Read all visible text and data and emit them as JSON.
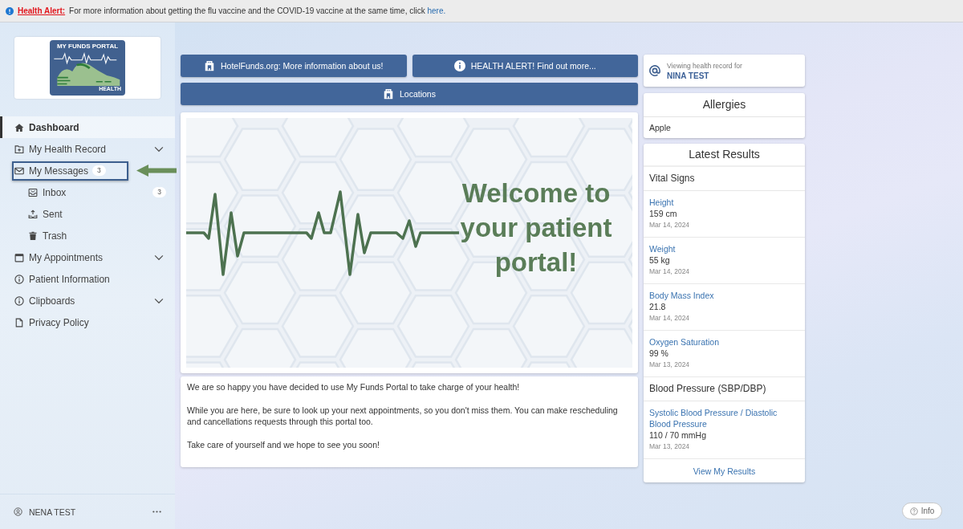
{
  "alert_bar": {
    "title": "Health Alert:",
    "message": "For more information about getting the flu vaccine and the COVID-19 vaccine at the same time, click",
    "link": "here."
  },
  "sidebar": {
    "logo": {
      "title": "MY FUNDS PORTAL",
      "subtitle": "HEALTH"
    },
    "items": [
      {
        "label": "Dashboard",
        "selected": true,
        "highlighted": false
      },
      {
        "label": "My Health Record",
        "selected": false,
        "highlighted": false,
        "expanded": false
      },
      {
        "label": "My Messages",
        "selected": false,
        "highlighted": true,
        "expanded": true,
        "badge": "3",
        "children": [
          {
            "label": "Inbox",
            "selected": false,
            "badge": "3"
          },
          {
            "label": "Sent",
            "selected": false
          },
          {
            "label": "Trash",
            "selected": false
          }
        ]
      },
      {
        "label": "My Appointments",
        "selected": false,
        "highlighted": false,
        "expanded": false
      },
      {
        "label": "Patient Information",
        "selected": false,
        "highlighted": false
      },
      {
        "label": "Clipboards",
        "selected": false,
        "highlighted": false,
        "expanded": false
      },
      {
        "label": "Privacy Policy",
        "selected": false,
        "highlighted": false
      }
    ],
    "user": {
      "name": "NENA TEST"
    }
  },
  "actions": [
    [
      {
        "label": "HotelFunds.org: More information about us!"
      },
      {
        "label": "HEALTH ALERT! Find out more..."
      }
    ],
    [
      {
        "label": "Locations"
      }
    ]
  ],
  "banner": {
    "heading": "Welcome to your patient portal!"
  },
  "welcome_text": [
    "We are so happy you have decided to use My Funds Portal to take charge of your health!",
    "While you are here, be sure to look up your next appointments, so you don't miss them. You can make rescheduling and cancellations requests through this portal too.",
    "Take care of yourself and we hope to see you soon!"
  ],
  "health_record": {
    "caption": "Viewing health record for",
    "name": "NINA TEST"
  },
  "allergies": {
    "title": "Allergies",
    "items": [
      "Apple"
    ]
  },
  "latest_results": {
    "title": "Latest Results",
    "groups": [
      {
        "title": "Vital Signs",
        "results": [
          {
            "name": "Height",
            "value": "159 cm",
            "date": "Mar 14, 2024"
          },
          {
            "name": "Weight",
            "value": "55 kg",
            "date": "Mar 14, 2024"
          },
          {
            "name": "Body Mass Index",
            "value": "21.8",
            "date": "Mar 14, 2024"
          },
          {
            "name": "Oxygen Saturation",
            "value": "99 %",
            "date": "Mar 13, 2024"
          }
        ]
      },
      {
        "title": "Blood Pressure (SBP/DBP)",
        "results": [
          {
            "name": "Systolic Blood Pressure / Diastolic Blood Pressure",
            "value": "110 / 70 mmHg",
            "date": "Mar 13, 2024"
          }
        ]
      }
    ],
    "link": "View My Results"
  },
  "info_button": {
    "label": "Info"
  }
}
